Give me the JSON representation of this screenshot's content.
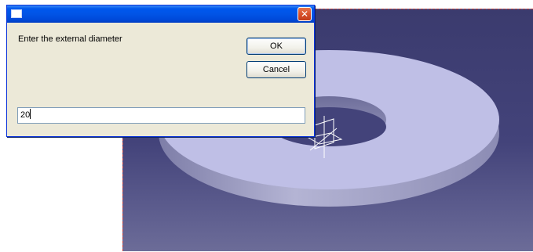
{
  "dialog": {
    "prompt": "Enter the external diameter",
    "ok_label": "OK",
    "cancel_label": "Cancel",
    "input_value": "20",
    "close_glyph": "✕"
  },
  "icons": {
    "title_icon": "window-icon",
    "close_icon": "close-icon",
    "axis_icon": "axis-compass-icon"
  },
  "colors": {
    "titlebar": "#0054e3",
    "dialog_background": "#ece9d8",
    "viewport_background": "#43437a",
    "part_face": "#bfbfe6"
  }
}
